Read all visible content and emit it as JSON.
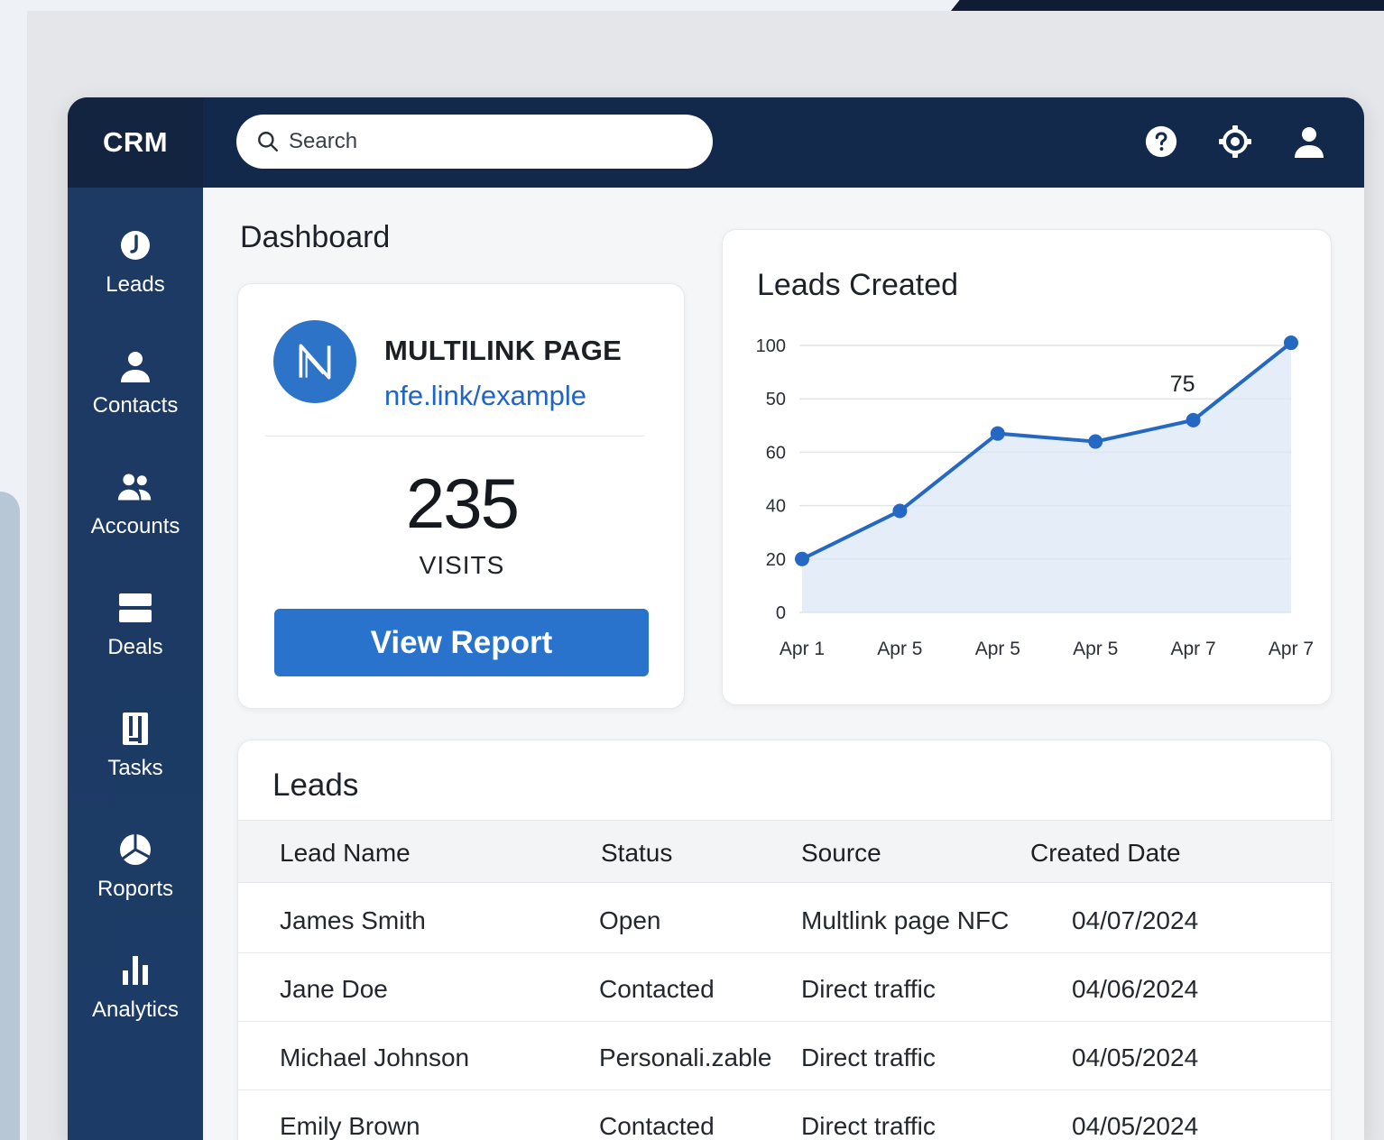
{
  "app": {
    "brand": "CRM"
  },
  "search": {
    "placeholder": "Search"
  },
  "header_icons": [
    "help-icon",
    "settings-icon",
    "user-icon"
  ],
  "sidebar": {
    "items": [
      {
        "label": "Leads",
        "icon": "leads-icon"
      },
      {
        "label": "Contacts",
        "icon": "contact-icon"
      },
      {
        "label": "Accounts",
        "icon": "accounts-icon"
      },
      {
        "label": "Deals",
        "icon": "deals-icon"
      },
      {
        "label": "Tasks",
        "icon": "tasks-icon"
      },
      {
        "label": "Roports",
        "icon": "reports-icon"
      },
      {
        "label": "Analytics",
        "icon": "analytics-icon"
      }
    ]
  },
  "page": {
    "title": "Dashboard"
  },
  "link_card": {
    "logo_letter": "N",
    "title": "MULTILINK PAGE",
    "url": "nfe.link/example",
    "visits": "235",
    "visits_label": "VISITS",
    "button": "View Report"
  },
  "colors": {
    "navy": "#13294b",
    "sidebar": "#1c3a63",
    "accent": "#2a73cc"
  },
  "chart_data": {
    "type": "line",
    "title": "Leads Created",
    "y_tick_labels": [
      "100",
      "50",
      "60",
      "40",
      "20",
      "0"
    ],
    "x_tick_labels": [
      "Apr 1",
      "Apr 5",
      "Apr 5",
      "Apr 5",
      "Apr 7",
      "Apr 7"
    ],
    "series": [
      {
        "values": [
          20,
          38,
          67,
          64,
          72,
          101
        ]
      }
    ],
    "point_annotation": {
      "point_index": 4,
      "text": "75"
    },
    "grid": true,
    "fill_area": true
  },
  "leads": {
    "title": "Leads",
    "columns": [
      "Lead Name",
      "Status",
      "Source",
      "Created Date"
    ],
    "rows": [
      [
        "James Smith",
        "Open",
        "Multlink page NFC",
        "04/07/2024"
      ],
      [
        "Jane Doe",
        "Contacted",
        "Direct traffic",
        "04/06/2024"
      ],
      [
        "Michael Johnson",
        "Personali.zable",
        "Direct traffic",
        "04/05/2024"
      ],
      [
        "Emily Brown",
        "Contacted",
        "Direct traffic",
        "04/05/2024"
      ]
    ]
  }
}
